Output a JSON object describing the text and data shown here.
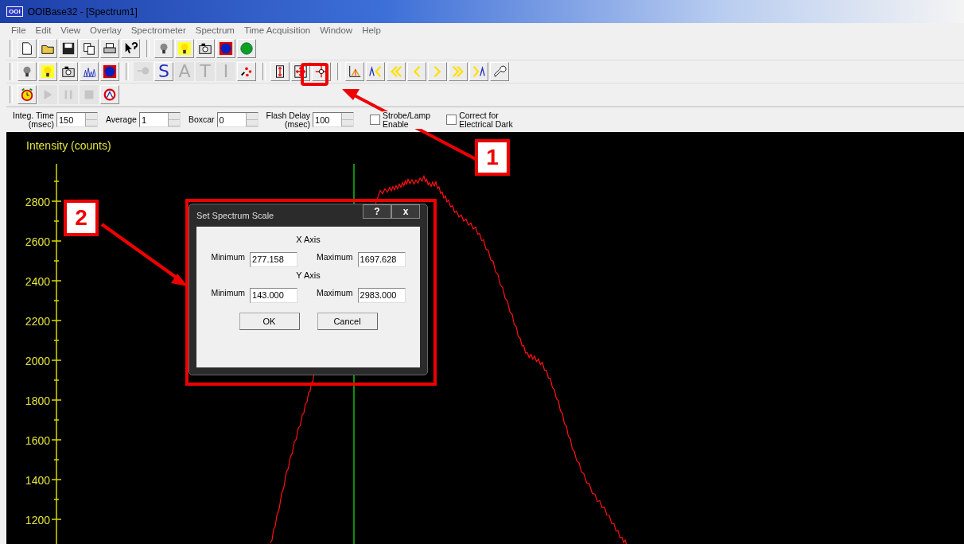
{
  "window": {
    "app_icon": "OOI",
    "title": "OOIBase32 - [Spectrum1]"
  },
  "menu": [
    "File",
    "Edit",
    "View",
    "Overlay",
    "Spectrometer",
    "Spectrum",
    "Time Acquisition",
    "Window",
    "Help"
  ],
  "toolbars": [
    [
      [
        {
          "kind": "new",
          "disabled": false
        },
        {
          "kind": "open",
          "disabled": false
        },
        {
          "kind": "save",
          "disabled": false
        },
        {
          "kind": "copy",
          "disabled": false
        },
        {
          "kind": "print",
          "disabled": false
        },
        {
          "kind": "help",
          "disabled": false
        }
      ],
      [
        {
          "kind": "bulb-off",
          "disabled": false
        },
        {
          "kind": "bulb-on",
          "disabled": false
        },
        {
          "kind": "camera",
          "disabled": false
        },
        {
          "kind": "target",
          "disabled": false
        },
        {
          "kind": "go",
          "disabled": false
        }
      ]
    ],
    [
      [
        {
          "kind": "bulb-off",
          "disabled": false
        },
        {
          "kind": "bulb-on",
          "disabled": false
        },
        {
          "kind": "camera",
          "disabled": false
        },
        {
          "kind": "spectrum",
          "disabled": false
        },
        {
          "kind": "target",
          "disabled": false
        }
      ],
      [
        {
          "kind": "lamp",
          "disabled": true
        },
        {
          "kind": "letter",
          "glyph": "S",
          "disabled": false
        },
        {
          "kind": "letter",
          "glyph": "A",
          "disabled": true
        },
        {
          "kind": "letter",
          "glyph": "T",
          "disabled": true
        },
        {
          "kind": "letter",
          "glyph": "I",
          "disabled": true
        },
        {
          "kind": "scatter",
          "disabled": false
        }
      ],
      [
        {
          "kind": "vscale",
          "disabled": false
        },
        {
          "kind": "fullscale",
          "disabled": false
        },
        {
          "kind": "cursor",
          "disabled": false
        }
      ],
      [
        {
          "kind": "axes",
          "disabled": false
        },
        {
          "kind": "first",
          "disabled": false
        },
        {
          "kind": "fast-left",
          "disabled": false
        },
        {
          "kind": "left",
          "disabled": false
        },
        {
          "kind": "right",
          "disabled": false
        },
        {
          "kind": "fast-right",
          "disabled": false
        },
        {
          "kind": "last",
          "disabled": false
        },
        {
          "kind": "wrench",
          "disabled": false
        }
      ]
    ],
    [
      [
        {
          "kind": "alarm",
          "disabled": false
        },
        {
          "kind": "play",
          "disabled": true
        },
        {
          "kind": "pause",
          "disabled": true
        },
        {
          "kind": "stop",
          "disabled": true
        },
        {
          "kind": "badge",
          "disabled": false
        }
      ]
    ]
  ],
  "controls": [
    {
      "kind": "spin",
      "label": "Integ. Time\n(msec)",
      "value": "150"
    },
    {
      "kind": "spin",
      "label": "Average",
      "value": "1"
    },
    {
      "kind": "spin",
      "label": "Boxcar",
      "value": "0"
    },
    {
      "kind": "spin",
      "label": "Flash Delay\n(msec)",
      "value": "100"
    },
    {
      "kind": "check",
      "label": "Strobe/Lamp\nEnable",
      "checked": false
    },
    {
      "kind": "check",
      "label": "Correct for\nElectrical Dark",
      "checked": false
    }
  ],
  "plot": {
    "y_label": "Intensity (counts)",
    "y_ticks": [
      "2800",
      "2600",
      "2400",
      "2200",
      "2000",
      "1800",
      "1600",
      "1400",
      "1200"
    ]
  },
  "dialog": {
    "title": "Set Spectrum Scale",
    "help": "?",
    "close": "x",
    "sections": [
      {
        "heading": "X Axis",
        "min_label": "Minimum",
        "min": "277.158",
        "max_label": "Maximum",
        "max": "1697.628"
      },
      {
        "heading": "Y Axis",
        "min_label": "Minimum",
        "min": "143.000",
        "max_label": "Maximum",
        "max": "2983.000"
      }
    ],
    "buttons": [
      "OK",
      "Cancel"
    ]
  },
  "annotations": [
    {
      "label": "1"
    },
    {
      "label": "2"
    }
  ]
}
